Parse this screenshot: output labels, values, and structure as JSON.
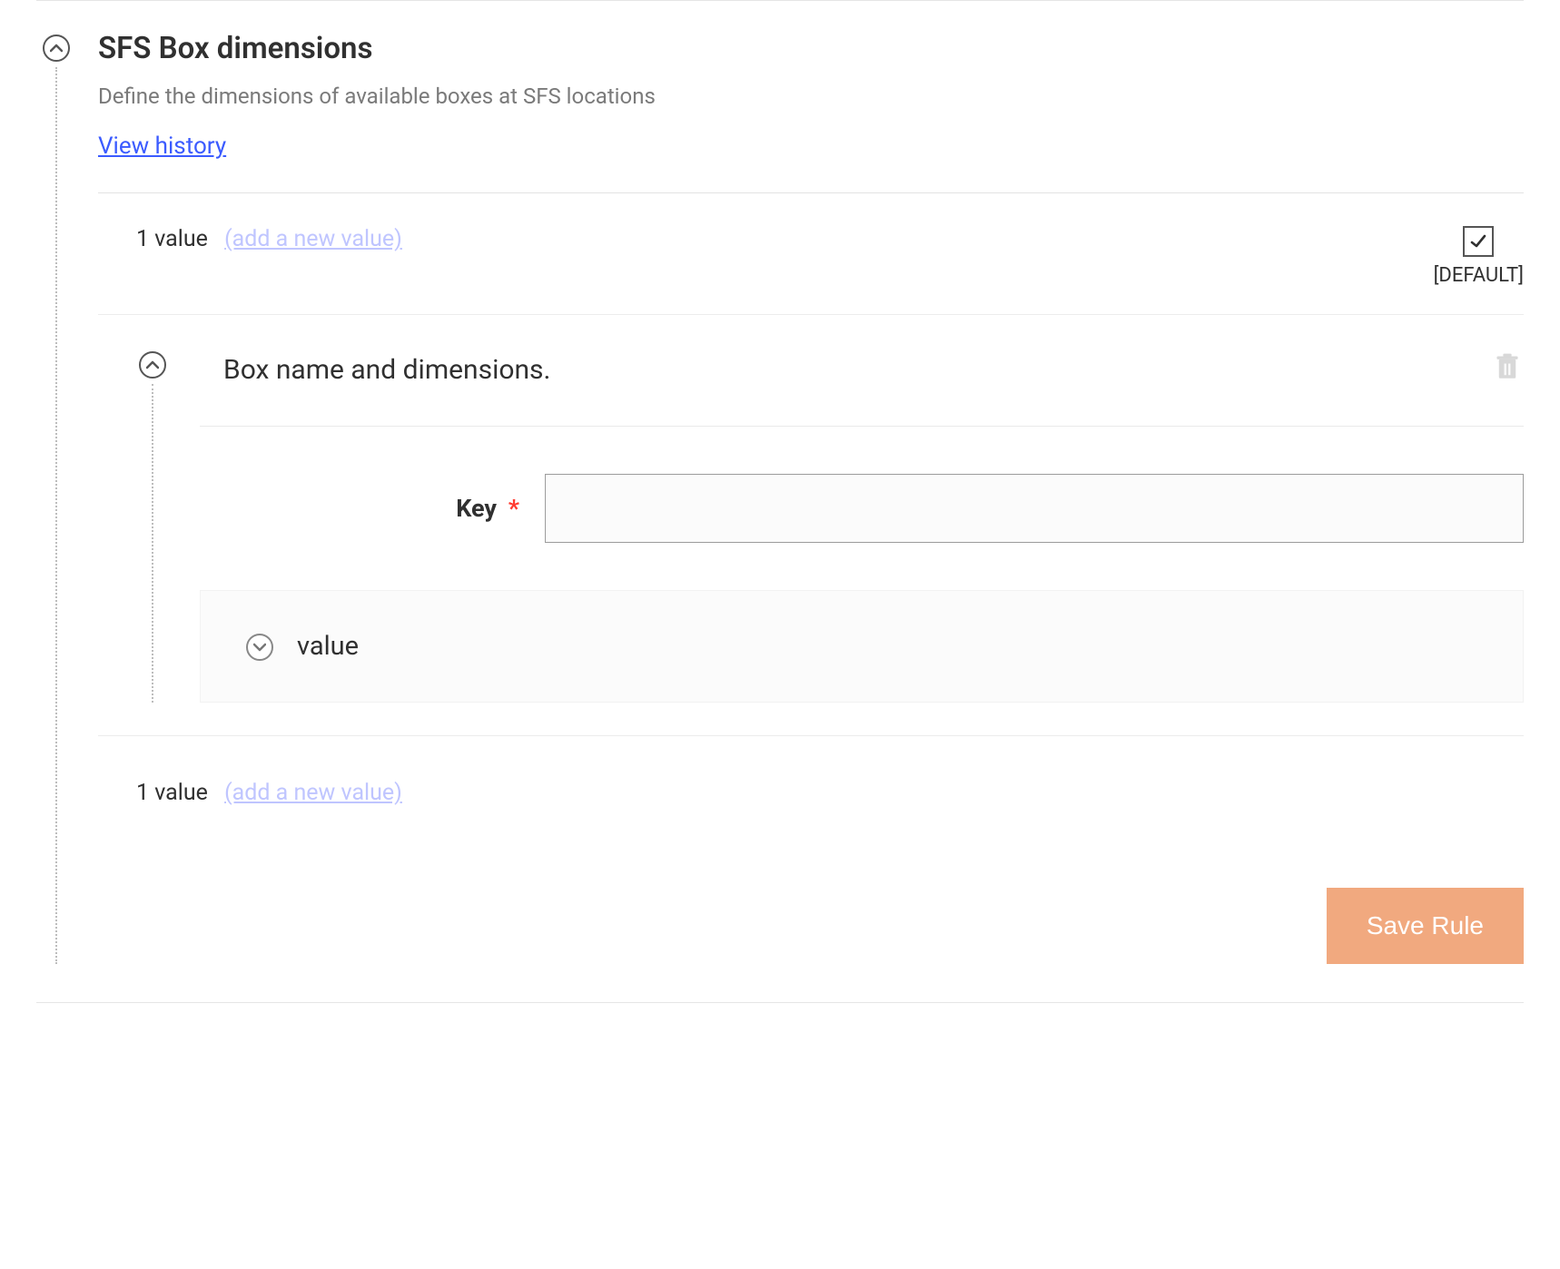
{
  "rule": {
    "title": "SFS Box dimensions",
    "subtitle": "Define the dimensions of available boxes at SFS locations",
    "view_history": "View history"
  },
  "values": {
    "top_count": "1 value",
    "top_add": "(add a new value)",
    "default_label": "[DEFAULT]",
    "bottom_count": "1 value",
    "bottom_add": "(add a new value)"
  },
  "box": {
    "title": "Box name and dimensions.",
    "key_label": "Key",
    "key_value": "",
    "value_label": "value"
  },
  "actions": {
    "save": "Save Rule"
  }
}
